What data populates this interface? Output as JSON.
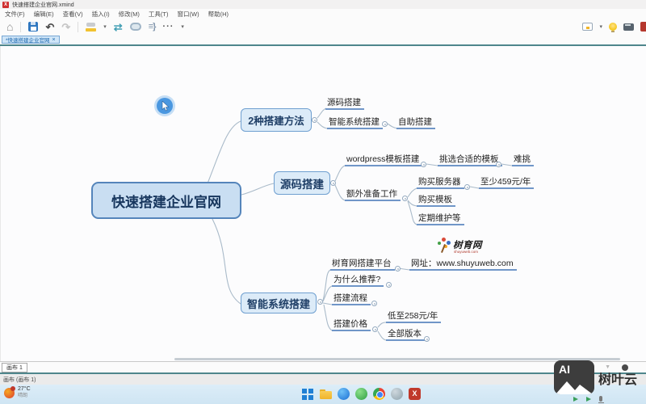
{
  "window": {
    "title": "快速搭建企业官网.xmind"
  },
  "menu_bar": {
    "items": [
      "文件(F)",
      "编辑(E)",
      "查看(V)",
      "插入(I)",
      "修改(M)",
      "工具(T)",
      "窗口(W)",
      "帮助(H)"
    ]
  },
  "toolbar": {
    "home": "⌂",
    "undo": "↶",
    "redo": "↷",
    "relationship": "⇄",
    "summary": "≡}",
    "more": "···",
    "dropdown": "▾"
  },
  "tab_bar": {
    "active_tab": "*快速搭建企业官网",
    "close": "×"
  },
  "mindmap": {
    "nodes": {
      "central": "快速搭建企业官网",
      "b1": "2种搭建方法",
      "b1c1": "源码搭建",
      "b1c2": "智能系统搭建",
      "b1c2c1": "自助搭建",
      "b2": "源码搭建",
      "b2c1": "wordpress模板搭建",
      "b2c1c1": "挑选合适的模板",
      "b2c1c1c1": "难挑",
      "b2c2": "额外准备工作",
      "b2c2c1": "购买服务器",
      "b2c2c1c1": "至少459元/年",
      "b2c2c2": "购买模板",
      "b2c2c3": "定期维护等",
      "b3": "智能系统搭建",
      "b3c1": "树育网搭建平台",
      "b3c1c1": "网址：www.shuyuweb.com",
      "b3c2": "为什么推荐?",
      "b3c3": "搭建流程",
      "b3c4": "搭建价格",
      "b3c4c1": "低至258元/年",
      "b3c4c2": "全部版本"
    },
    "logo": {
      "name": "树育网",
      "url": "shuyuweb.com"
    }
  },
  "sheet_bar": {
    "tab": "画布 1",
    "filter": "▼"
  },
  "status_bar": {
    "text": "画布 (画布 1)"
  },
  "taskbar": {
    "weather": {
      "temp": "27°C",
      "condition": "晴朗"
    }
  },
  "watermark": {
    "badge": "AI",
    "brand": "树叶云"
  },
  "colors": {
    "accent_teal": "#4e868c",
    "topic_fill": "#dcebf8",
    "topic_border": "#6f9fd0",
    "central_fill": "#c9def2",
    "central_border": "#5585bb",
    "underline": "#7096c8",
    "highlight_circle": "#4a97e0",
    "xmind_red": "#c0392b"
  }
}
